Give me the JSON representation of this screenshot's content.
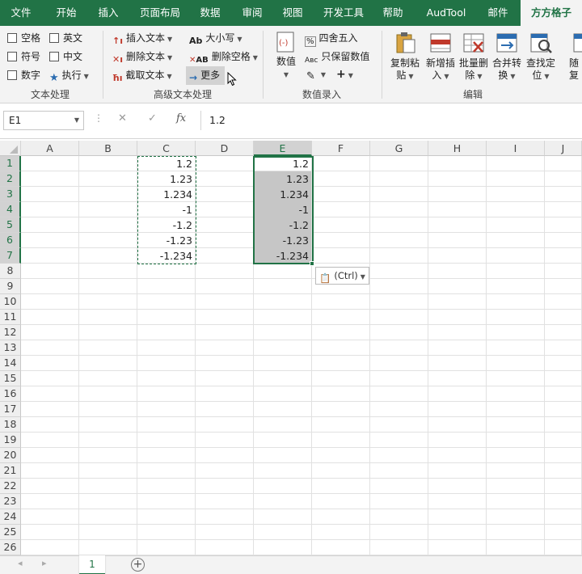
{
  "tabs": [
    "文件",
    "开始",
    "插入",
    "页面布局",
    "数据",
    "审阅",
    "视图",
    "开发工具",
    "帮助",
    "AudTool",
    "邮件",
    "方方格子"
  ],
  "active_tab": "方方格子",
  "ribbon": {
    "text_processing": {
      "checkboxes": [
        "空格",
        "英文",
        "符号",
        "中文",
        "数字"
      ],
      "execute": "执行",
      "label": "文本处理"
    },
    "advanced_text": {
      "insert_text": "插入文本",
      "delete_text": "删除文本",
      "extract_text": "截取文本",
      "case": "大小写",
      "delete_spaces": "删除空格",
      "more": "更多",
      "label": "高级文本处理"
    },
    "numeric_entry": {
      "value_btn": "数值",
      "round": "四舍五入",
      "keep_values": "只保留数值",
      "label": "数值录入"
    },
    "edit": {
      "copy_paste": [
        "复制粘",
        "贴"
      ],
      "batch_insert": [
        "新增插",
        "入"
      ],
      "batch_delete": [
        "批量删",
        "除"
      ],
      "merge_convert": [
        "合并转",
        "换"
      ],
      "find_locate": [
        "查找定",
        "位"
      ],
      "random": [
        "随",
        "复"
      ],
      "label": "编辑"
    }
  },
  "name_box": "E1",
  "formula": "1.2",
  "columns": [
    "A",
    "B",
    "C",
    "D",
    "E",
    "F",
    "G",
    "H",
    "I",
    "J"
  ],
  "selected_column": "E",
  "rows": [
    "1",
    "2",
    "3",
    "4",
    "5",
    "6",
    "7",
    "8",
    "9",
    "10",
    "11",
    "12",
    "13",
    "14",
    "15",
    "16",
    "17",
    "18",
    "19",
    "20",
    "21",
    "22",
    "23",
    "24",
    "25",
    "26"
  ],
  "column_c_values": [
    "1.2",
    "1.23",
    "1.234",
    "-1",
    "-1.2",
    "-1.23",
    "-1.234"
  ],
  "column_e_values": [
    "1.2",
    "1.23",
    "1.234",
    "-1",
    "-1.2",
    "-1.23",
    "-1.234"
  ],
  "paste_options": "(Ctrl)",
  "sheet_tab": "1",
  "colors": {
    "accent": "#217346",
    "selection": "#c6c6c6"
  }
}
